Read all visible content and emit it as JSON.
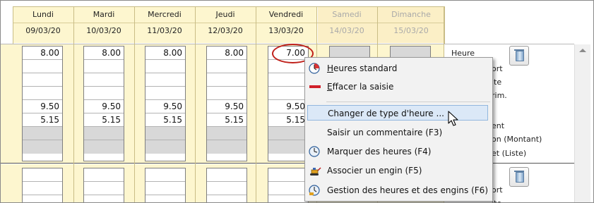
{
  "days": [
    {
      "name": "Lundi",
      "date": "09/03/20",
      "weekend": false
    },
    {
      "name": "Mardi",
      "date": "10/03/20",
      "weekend": false
    },
    {
      "name": "Mercredi",
      "date": "11/03/20",
      "weekend": false
    },
    {
      "name": "Jeudi",
      "date": "12/03/20",
      "weekend": false
    },
    {
      "name": "Vendredi",
      "date": "13/03/20",
      "weekend": false
    },
    {
      "name": "Samedi",
      "date": "14/03/20",
      "weekend": true
    },
    {
      "name": "Dimanche",
      "date": "15/03/20",
      "weekend": true
    }
  ],
  "block1": {
    "rows": [
      [
        "8.00",
        "8.00",
        "8.00",
        "8.00",
        "7.00"
      ],
      [
        "",
        "",
        "",
        "",
        ""
      ],
      [
        "",
        "",
        "",
        "",
        ""
      ],
      [
        "",
        "",
        "",
        "",
        ""
      ],
      [
        "9.50",
        "9.50",
        "9.50",
        "9.50",
        "9.50"
      ],
      [
        "5.15",
        "5.15",
        "5.15",
        "5.15",
        "5.15"
      ],
      [
        "",
        "",
        "",
        "",
        ""
      ],
      [
        "",
        "",
        "",
        "",
        ""
      ]
    ],
    "labels": [
      "Heure",
      "ort",
      "ite",
      "rim.",
      "",
      "ent",
      "on (Montant)",
      "et (Liste)"
    ]
  },
  "block2": {
    "labels": [
      "ort",
      "ite"
    ]
  },
  "context_menu": {
    "items": [
      {
        "pre": "",
        "key": "H",
        "post": "eures standard",
        "icon": "clock-standard-icon"
      },
      {
        "pre": "",
        "key": "E",
        "post": "ffacer la saisie",
        "icon": "red-dash-icon"
      },
      {
        "pre": "",
        "key": "",
        "post": "Changer de type d'heure ...",
        "icon": ""
      },
      {
        "pre": "",
        "key": "",
        "post": "Saisir un commentaire (F3)",
        "icon": ""
      },
      {
        "pre": "",
        "key": "",
        "post": "Marquer des heures (F4)",
        "icon": "clock-icon"
      },
      {
        "pre": "",
        "key": "",
        "post": "Associer un engin (F5)",
        "icon": "excavator-icon"
      },
      {
        "pre": "",
        "key": "",
        "post": "Gestion des heures et des engins (F6)",
        "icon": "clock-engine-icon"
      }
    ]
  },
  "colors": {
    "weekday_bg": "#fdf6cf",
    "highlight": "#dbe8f7",
    "annotation": "#c0201a"
  }
}
